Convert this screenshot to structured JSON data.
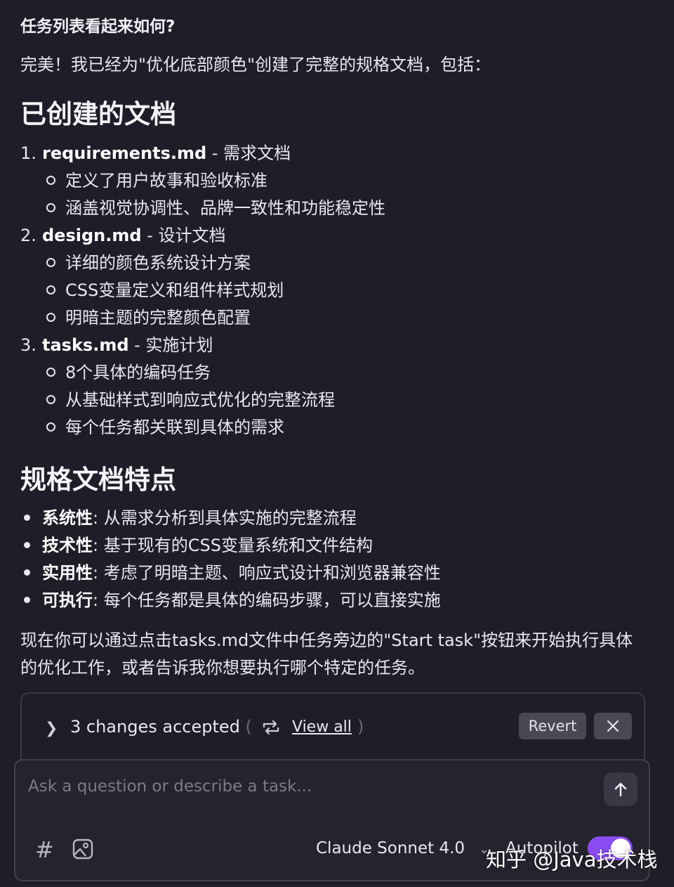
{
  "conversation": {
    "user_question": "任务列表看起来如何?",
    "intro": "完美！我已经为\"优化底部颜色\"创建了完整的规格文档，包括：",
    "section_created": {
      "heading": "已创建的文档",
      "items": [
        {
          "num": "1.",
          "file": "requirements.md",
          "desc": " - 需求文档",
          "subs": [
            "定义了用户故事和验收标准",
            "涵盖视觉协调性、品牌一致性和功能稳定性"
          ]
        },
        {
          "num": "2.",
          "file": "design.md",
          "desc": " - 设计文档",
          "subs": [
            "详细的颜色系统设计方案",
            "CSS变量定义和组件样式规划",
            "明暗主题的完整颜色配置"
          ]
        },
        {
          "num": "3.",
          "file": "tasks.md",
          "desc": " - 实施计划",
          "subs": [
            "8个具体的编码任务",
            "从基础样式到响应式优化的完整流程",
            "每个任务都关联到具体的需求"
          ]
        }
      ]
    },
    "section_features": {
      "heading": "规格文档特点",
      "items": [
        {
          "label": "系统性",
          "text": ": 从需求分析到具体实施的完整流程"
        },
        {
          "label": "技术性",
          "text": ": 基于现有的CSS变量系统和文件结构"
        },
        {
          "label": "实用性",
          "text": ": 考虑了明暗主题、响应式设计和浏览器兼容性"
        },
        {
          "label": "可执行",
          "text": ": 每个任务都是具体的编码步骤，可以直接实施"
        }
      ]
    },
    "outro": "现在你可以通过点击tasks.md文件中任务旁边的\"Start task\"按钮来开始执行具体的优化工作，或者告诉我你想要执行哪个特定的任务。"
  },
  "changes_bar": {
    "summary": "3 changes accepted",
    "paren_open": "(",
    "paren_close": ")",
    "view_all": "View all",
    "revert_label": "Revert"
  },
  "composer": {
    "placeholder": "Ask a question or describe a task...",
    "model": "Claude Sonnet 4.0",
    "autopilot_label": "Autopilot",
    "autopilot_on": true
  },
  "watermark": "知乎 @Java技术栈",
  "colors": {
    "background": "#1f1d27",
    "toggle_accent": "#8a4cf0",
    "button_bg": "#4a4855"
  }
}
